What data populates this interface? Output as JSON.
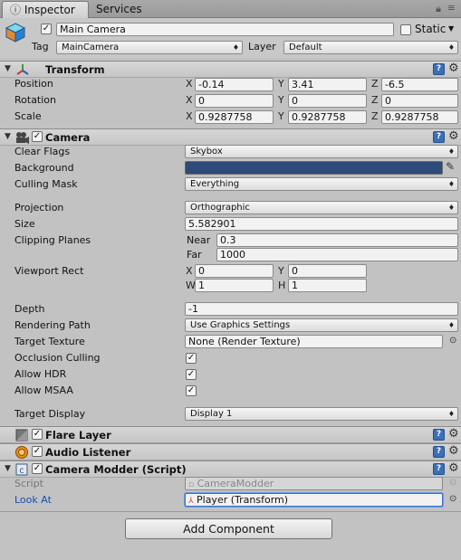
{
  "tabs": [
    {
      "label": "Inspector",
      "icon": "info-icon"
    },
    {
      "label": "Services"
    }
  ],
  "gameobject": {
    "name": "Main Camera",
    "static_label": "Static",
    "tag_label": "Tag",
    "tag_value": "MainCamera",
    "layer_label": "Layer",
    "layer_value": "Default"
  },
  "transform": {
    "title": "Transform",
    "rows": [
      {
        "label": "Position",
        "x": "-0.14",
        "y": "3.41",
        "z": "-6.5"
      },
      {
        "label": "Rotation",
        "x": "0",
        "y": "0",
        "z": "0"
      },
      {
        "label": "Scale",
        "x": "0.9287758",
        "y": "0.9287758",
        "z": "0.9287758"
      }
    ]
  },
  "axes": {
    "x": "X",
    "y": "Y",
    "z": "Z",
    "w": "W",
    "h": "H"
  },
  "camera": {
    "title": "Camera",
    "clear_flags_label": "Clear Flags",
    "clear_flags": "Skybox",
    "background_label": "Background",
    "background_color": "#2d4a78",
    "culling_mask_label": "Culling Mask",
    "culling_mask": "Everything",
    "projection_label": "Projection",
    "projection": "Orthographic",
    "size_label": "Size",
    "size": "5.582901",
    "clipping_label": "Clipping Planes",
    "near_label": "Near",
    "near": "0.3",
    "far_label": "Far",
    "far": "1000",
    "viewport_label": "Viewport Rect",
    "vp_x": "0",
    "vp_y": "0",
    "vp_w": "1",
    "vp_h": "1",
    "depth_label": "Depth",
    "depth": "-1",
    "rendering_path_label": "Rendering Path",
    "rendering_path": "Use Graphics Settings",
    "target_texture_label": "Target Texture",
    "target_texture": "None (Render Texture)",
    "occlusion_label": "Occlusion Culling",
    "hdr_label": "Allow HDR",
    "msaa_label": "Allow MSAA",
    "target_display_label": "Target Display",
    "target_display": "Display 1"
  },
  "flare": {
    "title": "Flare Layer"
  },
  "audio": {
    "title": "Audio Listener"
  },
  "modder": {
    "title": "Camera Modder (Script)",
    "script_label": "Script",
    "script_value": "CameraModder",
    "look_at_label": "Look At",
    "look_at_value": "Player (Transform)"
  },
  "add_component_label": "Add Component"
}
